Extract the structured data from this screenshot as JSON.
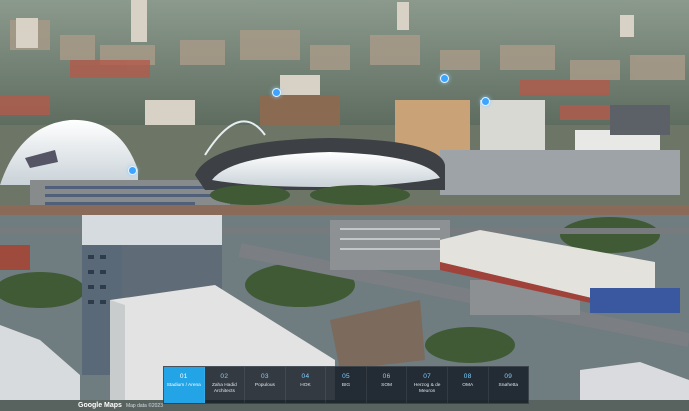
{
  "map": {
    "attribution_logo": "Google Maps",
    "attribution_credit": "Map data ©2023"
  },
  "toolbar": {
    "active_index": 0,
    "tabs": [
      {
        "num": "01",
        "label": "Stadium / Arena"
      },
      {
        "num": "02",
        "label": "Zaha Hadid Architects"
      },
      {
        "num": "03",
        "label": "Populous"
      },
      {
        "num": "04",
        "label": "HOK"
      },
      {
        "num": "05",
        "label": "BIG"
      },
      {
        "num": "06",
        "label": "SOM"
      },
      {
        "num": "07",
        "label": "Herzog & de Meuron"
      },
      {
        "num": "08",
        "label": "OMA"
      },
      {
        "num": "09",
        "label": "Snøhetta"
      }
    ]
  },
  "colors": {
    "accent": "#22a4e6",
    "panel": "#161e28",
    "pin": "#3da5ff"
  },
  "icons": {
    "pin": "location-pin-icon"
  }
}
